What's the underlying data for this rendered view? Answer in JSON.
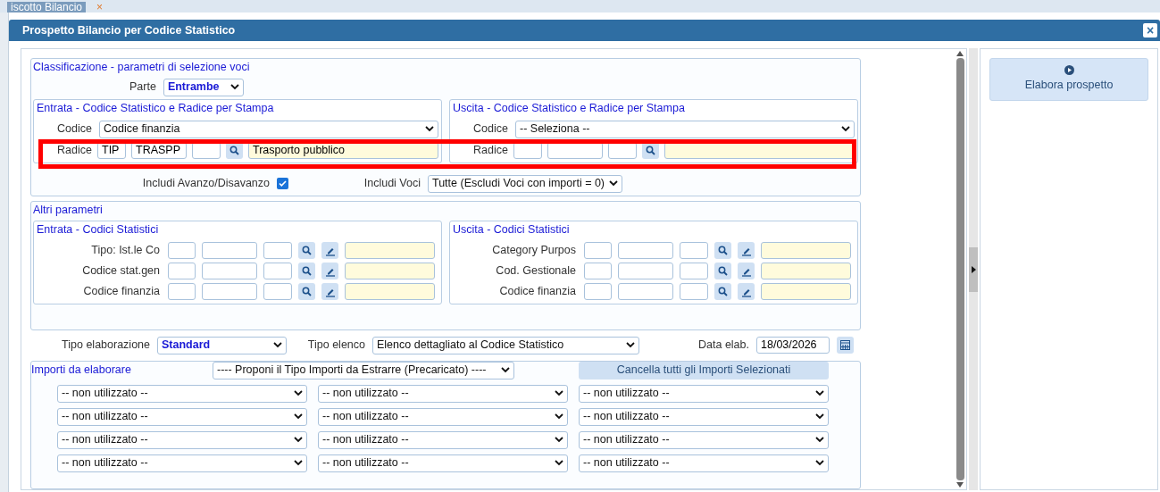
{
  "background_tab": {
    "label": "iscotto Bilancio",
    "close": "×"
  },
  "dialog": {
    "title": "Prospetto Bilancio per Codice Statistico",
    "close": "×"
  },
  "classificazione": {
    "title": "Classificazione - parametri di selezione voci",
    "parte": {
      "label": "Parte",
      "value": "Entrambe"
    },
    "entrata": {
      "title": "Entrata - Codice Statistico e Radice per Stampa",
      "codice": {
        "label": "Codice",
        "value": "Codice finanzia"
      },
      "radice": {
        "label": "Radice",
        "values": [
          "TIP",
          "TRASPP"
        ],
        "description": "Trasporto pubblico"
      }
    },
    "uscita": {
      "title": "Uscita - Codice Statistico e Radice per Stampa",
      "codice": {
        "label": "Codice",
        "value": "-- Seleziona --"
      },
      "radice": {
        "label": "Radice"
      }
    },
    "includi_avanzo": {
      "label": "Includi Avanzo/Disavanzo",
      "checked": true
    },
    "includi_voci": {
      "label": "Includi Voci",
      "value": "Tutte (Escludi Voci con importi = 0)"
    }
  },
  "altri_parametri": {
    "title": "Altri parametri",
    "entrata": {
      "title": "Entrata - Codici Statistici",
      "rows": [
        {
          "label": "Tipo: Ist.le Co"
        },
        {
          "label": "Codice stat.gen"
        },
        {
          "label": "Codice finanzia"
        }
      ]
    },
    "uscita": {
      "title": "Uscita - Codici Statistici",
      "rows": [
        {
          "label": "Category Purpos"
        },
        {
          "label": "Cod. Gestionale"
        },
        {
          "label": "Codice finanzia"
        }
      ]
    }
  },
  "tipo_elaborazione": {
    "label": "Tipo elaborazione",
    "value": "Standard"
  },
  "tipo_elenco": {
    "label": "Tipo elenco",
    "value": "Elenco dettagliato al Codice Statistico"
  },
  "data_elab": {
    "label": "Data elab.",
    "value": "18/03/2026"
  },
  "importi": {
    "title": "Importi da elaborare",
    "proponi": "---- Proponi il Tipo Importi da Estrarre (Precaricato) ----",
    "cancella": "Cancella tutti gli Importi Selezionati",
    "selects": [
      [
        "-- non utilizzato --",
        "-- non utilizzato --",
        "-- non utilizzato --"
      ],
      [
        "-- non utilizzato --",
        "-- non utilizzato --",
        "-- non utilizzato --"
      ],
      [
        "-- non utilizzato --",
        "-- non utilizzato --",
        "-- non utilizzato --"
      ],
      [
        "-- non utilizzato --",
        "-- non utilizzato --",
        "-- non utilizzato --"
      ]
    ]
  },
  "side": {
    "button": "Elabora prospetto"
  }
}
